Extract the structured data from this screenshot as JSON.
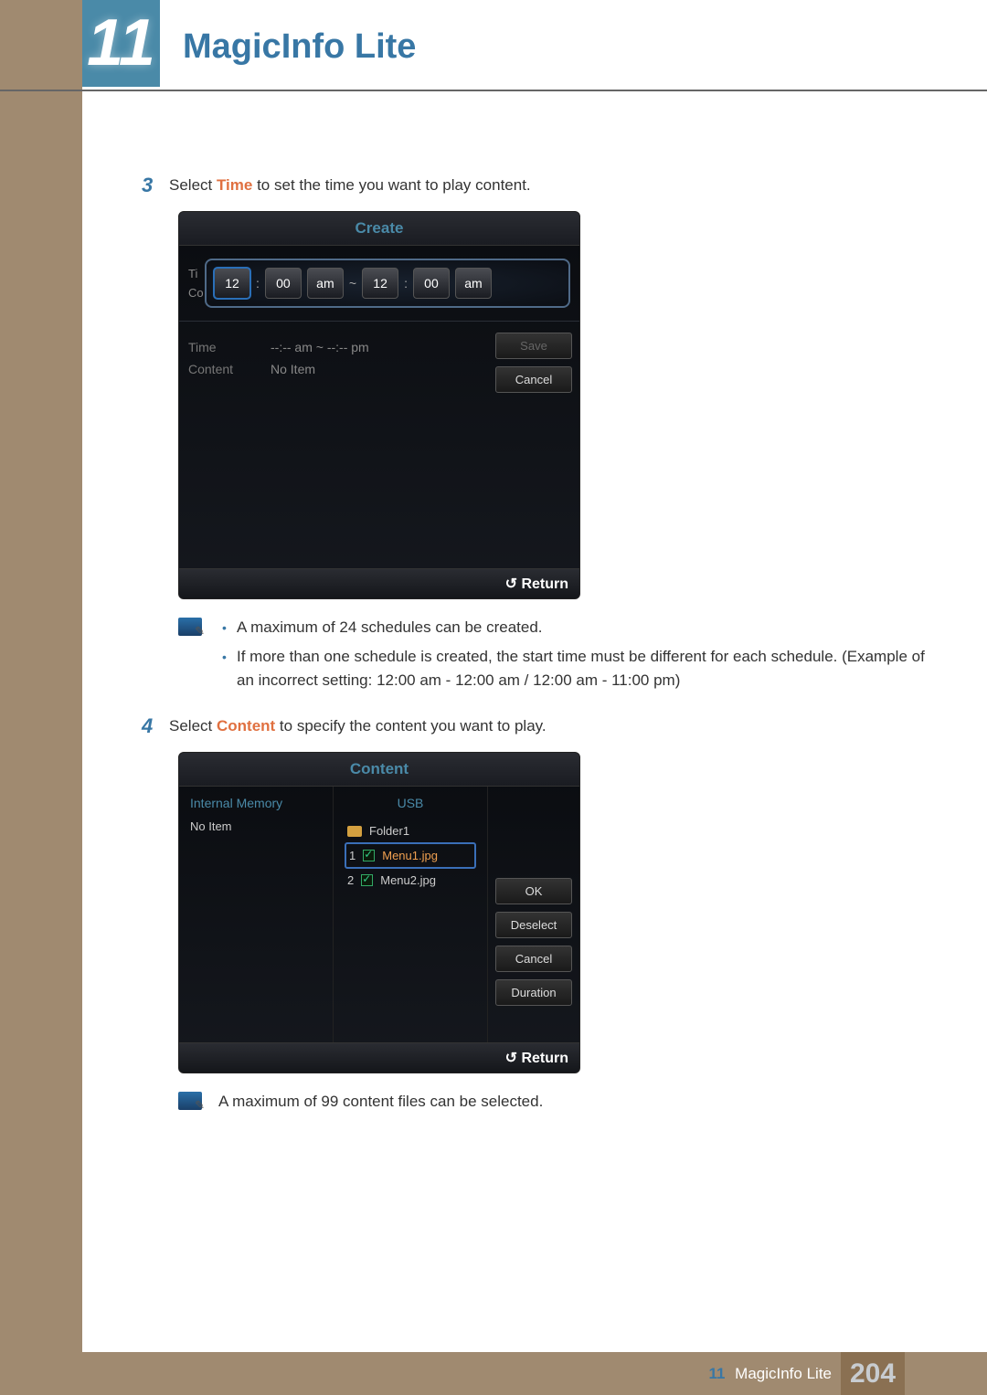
{
  "chapter": {
    "number": "11",
    "title": "MagicInfo Lite"
  },
  "steps": {
    "s3": {
      "num": "3",
      "pre": "Select ",
      "hl": "Time",
      "post": " to set the time you want to play content."
    },
    "s4": {
      "num": "4",
      "pre": "Select ",
      "hl": "Content",
      "post": " to specify the content you want to play."
    }
  },
  "create_panel": {
    "title": "Create",
    "labels": {
      "ti": "Ti",
      "co": "Co"
    },
    "time": {
      "h1": "12",
      "m1": "00",
      "ap1": "am",
      "tilde": "~",
      "h2": "12",
      "m2": "00",
      "ap2": "am",
      "colon": ":"
    },
    "rows": {
      "time_k": "Time",
      "time_v": "--:-- am ~ --:-- pm",
      "content_k": "Content",
      "content_v": "No Item"
    },
    "buttons": {
      "save": "Save",
      "cancel": "Cancel"
    },
    "return": "Return"
  },
  "notes1": {
    "a": "A maximum of 24 schedules can be created.",
    "b": "If more than one schedule is created, the start time must be different for each schedule. (Example of an incorrect setting: 12:00 am - 12:00 am / 12:00 am - 11:00 pm)"
  },
  "content_panel": {
    "title": "Content",
    "col1": {
      "head": "Internal Memory",
      "empty": "No Item"
    },
    "col2": {
      "head": "USB",
      "folder": "Folder1",
      "f1_num": "1",
      "f1": "Menu1.jpg",
      "f2_num": "2",
      "f2": "Menu2.jpg"
    },
    "buttons": {
      "ok": "OK",
      "deselect": "Deselect",
      "cancel": "Cancel",
      "duration": "Duration"
    },
    "return": "Return"
  },
  "notes2": {
    "a": "A maximum of 99 content files can be selected."
  },
  "footer": {
    "chap": "11",
    "title": "MagicInfo Lite",
    "page": "204"
  }
}
